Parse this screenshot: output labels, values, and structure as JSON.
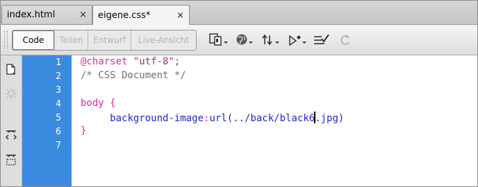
{
  "tabs": [
    {
      "label": "index.html",
      "close": "×"
    },
    {
      "label": "eigene.css*",
      "close": "×"
    }
  ],
  "toolbar": {
    "view_buttons": [
      "Code",
      "Teilen",
      "Entwurf",
      "Live-Ansicht"
    ],
    "icons": [
      "multiscreen-icon",
      "browser-preview-icon",
      "file-management-icon",
      "debug-icon",
      "validate-icon",
      "refresh-icon"
    ]
  },
  "sidebar_icons": [
    "open-documents-icon",
    "highlight-invalid-icon",
    "collapse-full-tag-icon",
    "collapse-selection-icon"
  ],
  "editor": {
    "line_numbers": [
      "1",
      "2",
      "3",
      "4",
      "5",
      "6",
      "7"
    ],
    "lines": {
      "l1_at": "@charset",
      "l1_str": " \"utf-8\";",
      "l2": "/* CSS Document */",
      "l4_sel": "body",
      "l4_brace": " {",
      "l5_indent": "     ",
      "l5_prop": "background-image",
      "l5_colon": ":",
      "l5_val_before": "url(../back/black",
      "l5_val_caret_char": "6",
      "l5_val_after": ".jpg)",
      "l6": "}"
    }
  },
  "colors": {
    "gutter": "#3a8be0",
    "selector": "#d72aa3",
    "property": "#2424c4",
    "comment": "#6f6f6f"
  }
}
